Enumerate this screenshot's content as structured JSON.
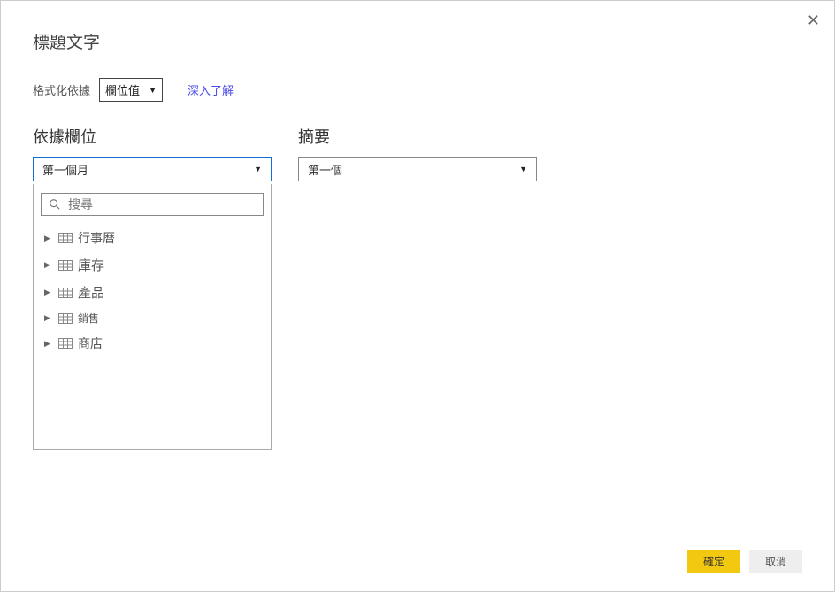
{
  "dialog": {
    "title": "標題文字"
  },
  "format": {
    "label": "格式化依據",
    "select_value": "欄位值",
    "learn_more": "深入了解"
  },
  "based_on": {
    "label": "依據欄位",
    "selected": "第一個月",
    "search_placeholder": "搜尋",
    "tree": [
      {
        "label": "行事曆"
      },
      {
        "label": "庫存"
      },
      {
        "label": "產品"
      },
      {
        "label": "銷售"
      },
      {
        "label": "商店"
      }
    ]
  },
  "summary": {
    "label": "摘要",
    "selected": "第一個"
  },
  "footer": {
    "ok": "確定",
    "cancel": "取消"
  }
}
